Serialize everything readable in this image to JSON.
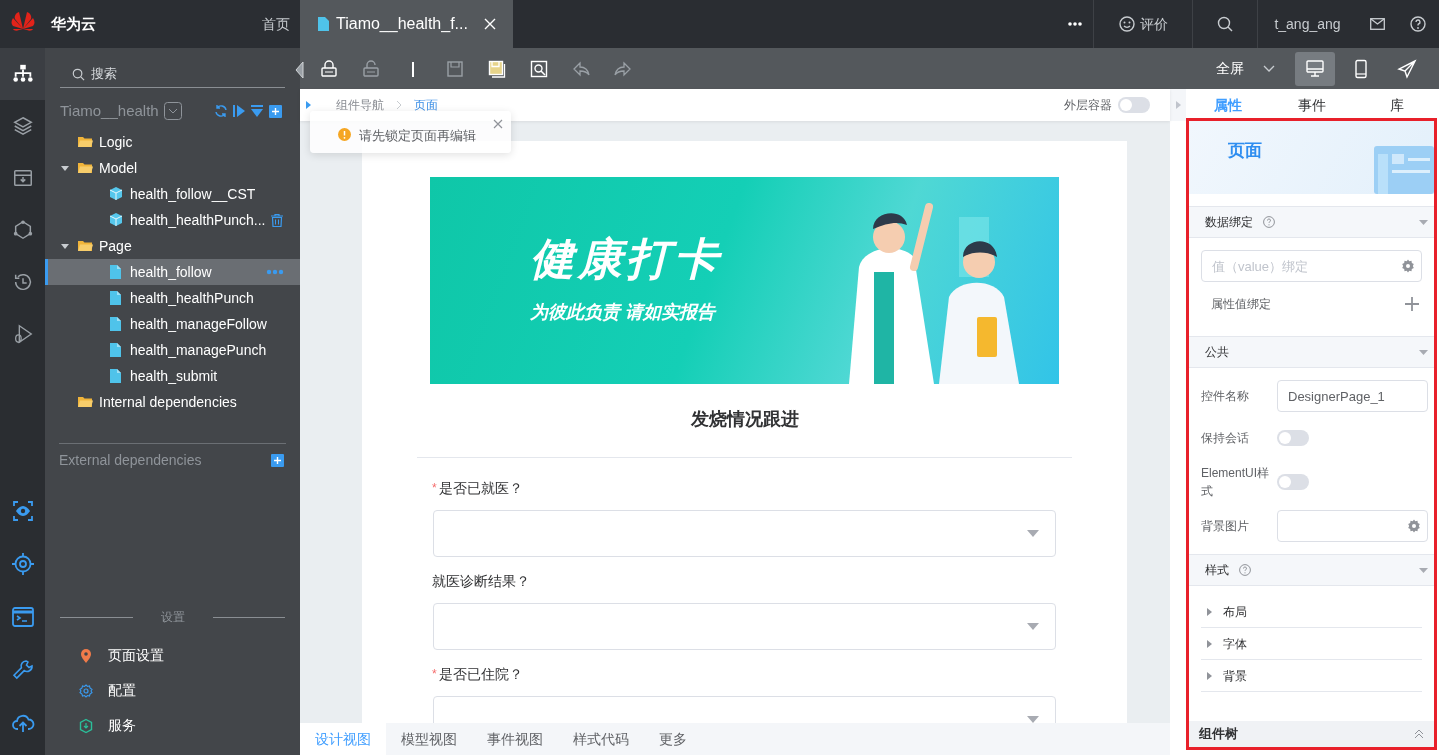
{
  "header": {
    "brand": "华为云",
    "home": "首页"
  },
  "rail": [
    {
      "kind": "sitemap",
      "selected": true
    },
    {
      "kind": "layers",
      "selected": false
    },
    {
      "kind": "archive",
      "selected": false
    },
    {
      "kind": "nodes",
      "selected": false
    },
    {
      "kind": "history",
      "selected": false
    },
    {
      "kind": "debug",
      "selected": false
    }
  ],
  "rail_bottom": [
    {
      "kind": "eye"
    },
    {
      "kind": "target"
    },
    {
      "kind": "terminal"
    },
    {
      "kind": "wrench"
    },
    {
      "kind": "cloud"
    }
  ],
  "explorer": {
    "search_placeholder": "搜索",
    "project": "Tiamo__health",
    "tree": [
      {
        "label": "Logic",
        "kind": "folder",
        "selected": false
      },
      {
        "label": "Model",
        "kind": "folder",
        "expanded": true,
        "selected": false,
        "children": [
          {
            "label": "health_follow__CST",
            "kind": "model",
            "selected": false,
            "hovered": false
          },
          {
            "label": "health_healthPunch...",
            "kind": "model",
            "selected": false,
            "hovered": true
          }
        ]
      },
      {
        "label": "Page",
        "kind": "folder",
        "expanded": true,
        "selected": false,
        "children": [
          {
            "label": "health_follow",
            "kind": "page",
            "selected": true,
            "hovered": false
          },
          {
            "label": "health_healthPunch",
            "kind": "page",
            "selected": false,
            "hovered": false
          },
          {
            "label": "health_manageFollow",
            "kind": "page",
            "selected": false,
            "hovered": false
          },
          {
            "label": "health_managePunch",
            "kind": "page",
            "selected": false,
            "hovered": false
          },
          {
            "label": "health_submit",
            "kind": "page",
            "selected": false,
            "hovered": false
          }
        ]
      },
      {
        "label": "Internal dependencies",
        "kind": "folder",
        "selected": false
      }
    ],
    "external": "External dependencies"
  },
  "settings": {
    "title": "设置",
    "items": [
      {
        "label": "页面设置",
        "kind": "pin"
      },
      {
        "label": "配置",
        "kind": "gear"
      },
      {
        "label": "服务",
        "kind": "service"
      }
    ]
  },
  "tabs": [
    {
      "label": "Tiamo__health_f...",
      "selected": true
    }
  ],
  "topbar": {
    "rate": "评价",
    "user": "t_ang_ang"
  },
  "toolbar": {
    "zoom": "全屏",
    "tools": [
      {
        "kind": "lock",
        "disabled": false
      },
      {
        "kind": "unlock",
        "disabled": true
      },
      {
        "kind": "bar",
        "disabled": false
      },
      {
        "kind": "save",
        "disabled": true
      },
      {
        "kind": "saveall",
        "disabled": false
      },
      {
        "kind": "preview",
        "disabled": false
      },
      {
        "kind": "undo",
        "disabled": true
      },
      {
        "kind": "redo",
        "disabled": true
      }
    ],
    "devices": [
      {
        "kind": "desktop",
        "selected": true
      },
      {
        "kind": "mobile",
        "selected": false
      },
      {
        "kind": "send",
        "selected": false
      }
    ]
  },
  "breadcrumb": [
    "组件导航",
    "页面"
  ],
  "outer_container": {
    "label": "外层容器",
    "on": false
  },
  "toast": "请先锁定页面再编辑",
  "form": {
    "required_mark": "*",
    "banner_title": "健康打卡",
    "banner_subtitle": "为彼此负责 请如实报告",
    "title": "发烧情况跟进",
    "fields": [
      {
        "label": "是否已就医？",
        "required": true
      },
      {
        "label": "就医诊断结果？",
        "required": false
      },
      {
        "label": "是否已住院？",
        "required": true
      }
    ]
  },
  "bottom_tabs": [
    {
      "label": "设计视图",
      "selected": true
    },
    {
      "label": "模型视图",
      "selected": false
    },
    {
      "label": "事件视图",
      "selected": false
    },
    {
      "label": "样式代码",
      "selected": false
    },
    {
      "label": "更多",
      "selected": false
    }
  ],
  "props_tabs": [
    {
      "label": "属性",
      "selected": true
    },
    {
      "label": "事件",
      "selected": false
    },
    {
      "label": "库",
      "selected": false
    }
  ],
  "props": {
    "header": "页面",
    "binding": {
      "title": "数据绑定",
      "placeholder": "值（value）绑定",
      "attr": "属性值绑定"
    },
    "common": {
      "title": "公共",
      "rows": [
        {
          "label": "控件名称",
          "kind": "input",
          "value": "DesignerPage_1"
        },
        {
          "label": "保持会话",
          "kind": "switch",
          "on": false
        },
        {
          "label": "ElementUI样式",
          "kind": "switch",
          "on": false
        },
        {
          "label": "背景图片",
          "kind": "picker"
        }
      ]
    },
    "style": {
      "title": "样式",
      "groups": [
        "布局",
        "字体",
        "背景"
      ]
    },
    "tree_title": "组件树"
  }
}
